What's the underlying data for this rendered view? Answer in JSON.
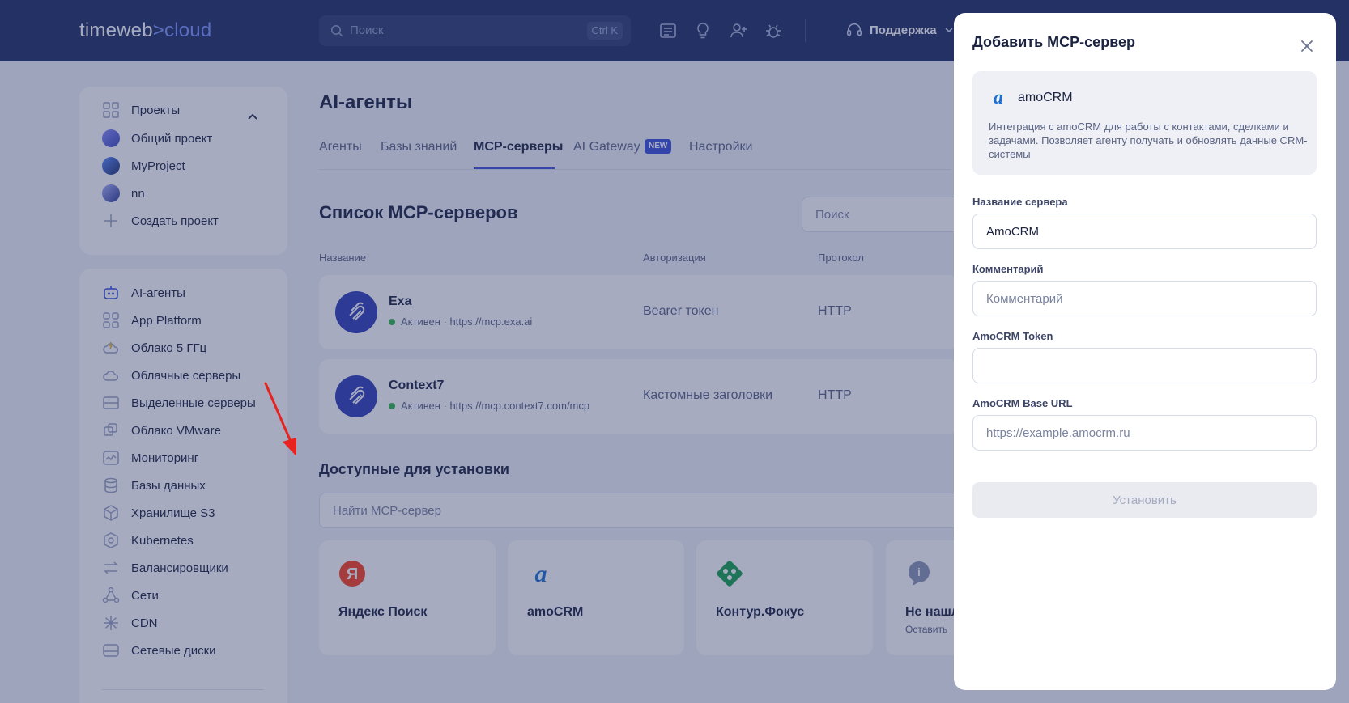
{
  "header": {
    "logo_main": "timeweb",
    "logo_sep": ">",
    "logo_accent": "cloud",
    "search_placeholder": "Поиск",
    "search_shortcut": "Ctrl K",
    "support_label": "Поддержка"
  },
  "sidebar": {
    "projects_title": "Проекты",
    "projects": [
      "Общий проект",
      "MyProject",
      "nn"
    ],
    "create_project": "Создать проект",
    "nav": [
      {
        "label": "AI-агенты",
        "icon": "robot-icon"
      },
      {
        "label": "App Platform",
        "icon": "apps-icon"
      },
      {
        "label": "Облако 5 ГГц",
        "icon": "cloud-bolt-icon"
      },
      {
        "label": "Облачные серверы",
        "icon": "cloud-icon"
      },
      {
        "label": "Выделенные серверы",
        "icon": "server-icon"
      },
      {
        "label": "Облако VMware",
        "icon": "vmware-icon"
      },
      {
        "label": "Мониторинг",
        "icon": "monitoring-icon"
      },
      {
        "label": "Базы данных",
        "icon": "database-icon"
      },
      {
        "label": "Хранилище S3",
        "icon": "storage-icon"
      },
      {
        "label": "Kubernetes",
        "icon": "kubernetes-icon"
      },
      {
        "label": "Балансировщики",
        "icon": "balancer-icon"
      },
      {
        "label": "Сети",
        "icon": "network-icon"
      },
      {
        "label": "CDN",
        "icon": "cdn-icon"
      },
      {
        "label": "Сетевые диски",
        "icon": "disk-icon"
      }
    ]
  },
  "main": {
    "title": "AI-агенты",
    "tabs": [
      "Агенты",
      "Базы знаний",
      "MCP-серверы",
      "AI Gateway",
      "Настройки"
    ],
    "active_tab": "MCP-серверы",
    "new_badge": "NEW",
    "list_title": "Список MCP-серверов",
    "list_search_placeholder": "Поиск",
    "columns": [
      "Название",
      "Авторизация",
      "Протокол"
    ],
    "servers": [
      {
        "name": "Exa",
        "status": "Активен · https://mcp.exa.ai",
        "auth": "Bearer токен",
        "protocol": "HTTP"
      },
      {
        "name": "Context7",
        "status": "Активен · https://mcp.context7.com/mcp",
        "auth": "Кастомные заголовки",
        "protocol": "HTTP"
      }
    ],
    "available_title": "Доступные для установки",
    "available_search_placeholder": "Найти MCP-сервер",
    "available": [
      {
        "name": "Яндекс Поиск",
        "sub": ""
      },
      {
        "name": "amoCRM",
        "sub": ""
      },
      {
        "name": "Контур.Фокус",
        "sub": ""
      },
      {
        "name": "Не нашли",
        "sub": "Оставить"
      }
    ]
  },
  "modal": {
    "title": "Добавить MCP-сервер",
    "integration_name": "amoCRM",
    "integration_desc": "Интеграция с amoCRM для работы с контактами, сделками и задачами. Позволяет агенту получать и обновлять данные CRM-системы",
    "fields": [
      {
        "label": "Название сервера",
        "value": "AmoCRM",
        "placeholder": ""
      },
      {
        "label": "Комментарий",
        "value": "",
        "placeholder": "Комментарий"
      },
      {
        "label": "AmoCRM Token",
        "value": "",
        "placeholder": ""
      },
      {
        "label": "AmoCRM Base URL",
        "value": "",
        "placeholder": "https://example.amocrm.ru"
      }
    ],
    "install_label": "Установить"
  },
  "colors": {
    "header_bg": "#1f2d61",
    "accent": "#3a50d9",
    "overlay": "#2a3769",
    "status_active": "#33b44a"
  }
}
